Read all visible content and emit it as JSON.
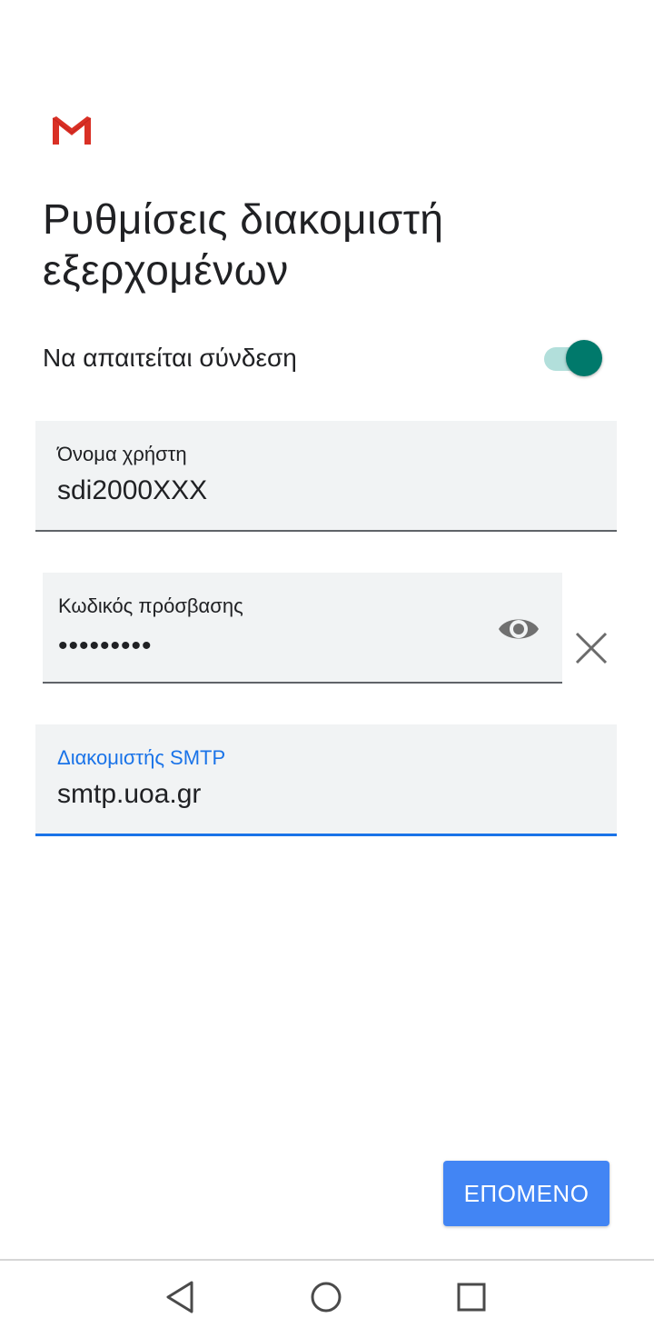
{
  "app": {
    "logo_icon": "gmail-logo-icon",
    "brand_color": "#d93025"
  },
  "header": {
    "title": "Ρυθμίσεις διακομιστή εξερχομένων"
  },
  "require_signin": {
    "label": "Να απαιτείται σύνδεση",
    "enabled": true,
    "accent_color": "#00796b"
  },
  "username": {
    "label": "Όνομα χρήστη",
    "value": "sdi2000XXX"
  },
  "password": {
    "label": "Κωδικός πρόσβασης",
    "value": "•••••••••",
    "visibility_icon": "eye-icon",
    "clear_icon": "close-icon"
  },
  "smtp": {
    "label": "Διακομιστής SMTP",
    "value": "smtp.uoa.gr",
    "focus_color": "#1a73e8"
  },
  "actions": {
    "next_label": "ΕΠΟΜΕΝΟ",
    "next_color": "#4285f4"
  },
  "navbar": {
    "back_icon": "back-triangle-icon",
    "home_icon": "home-circle-icon",
    "recents_icon": "recents-square-icon"
  }
}
